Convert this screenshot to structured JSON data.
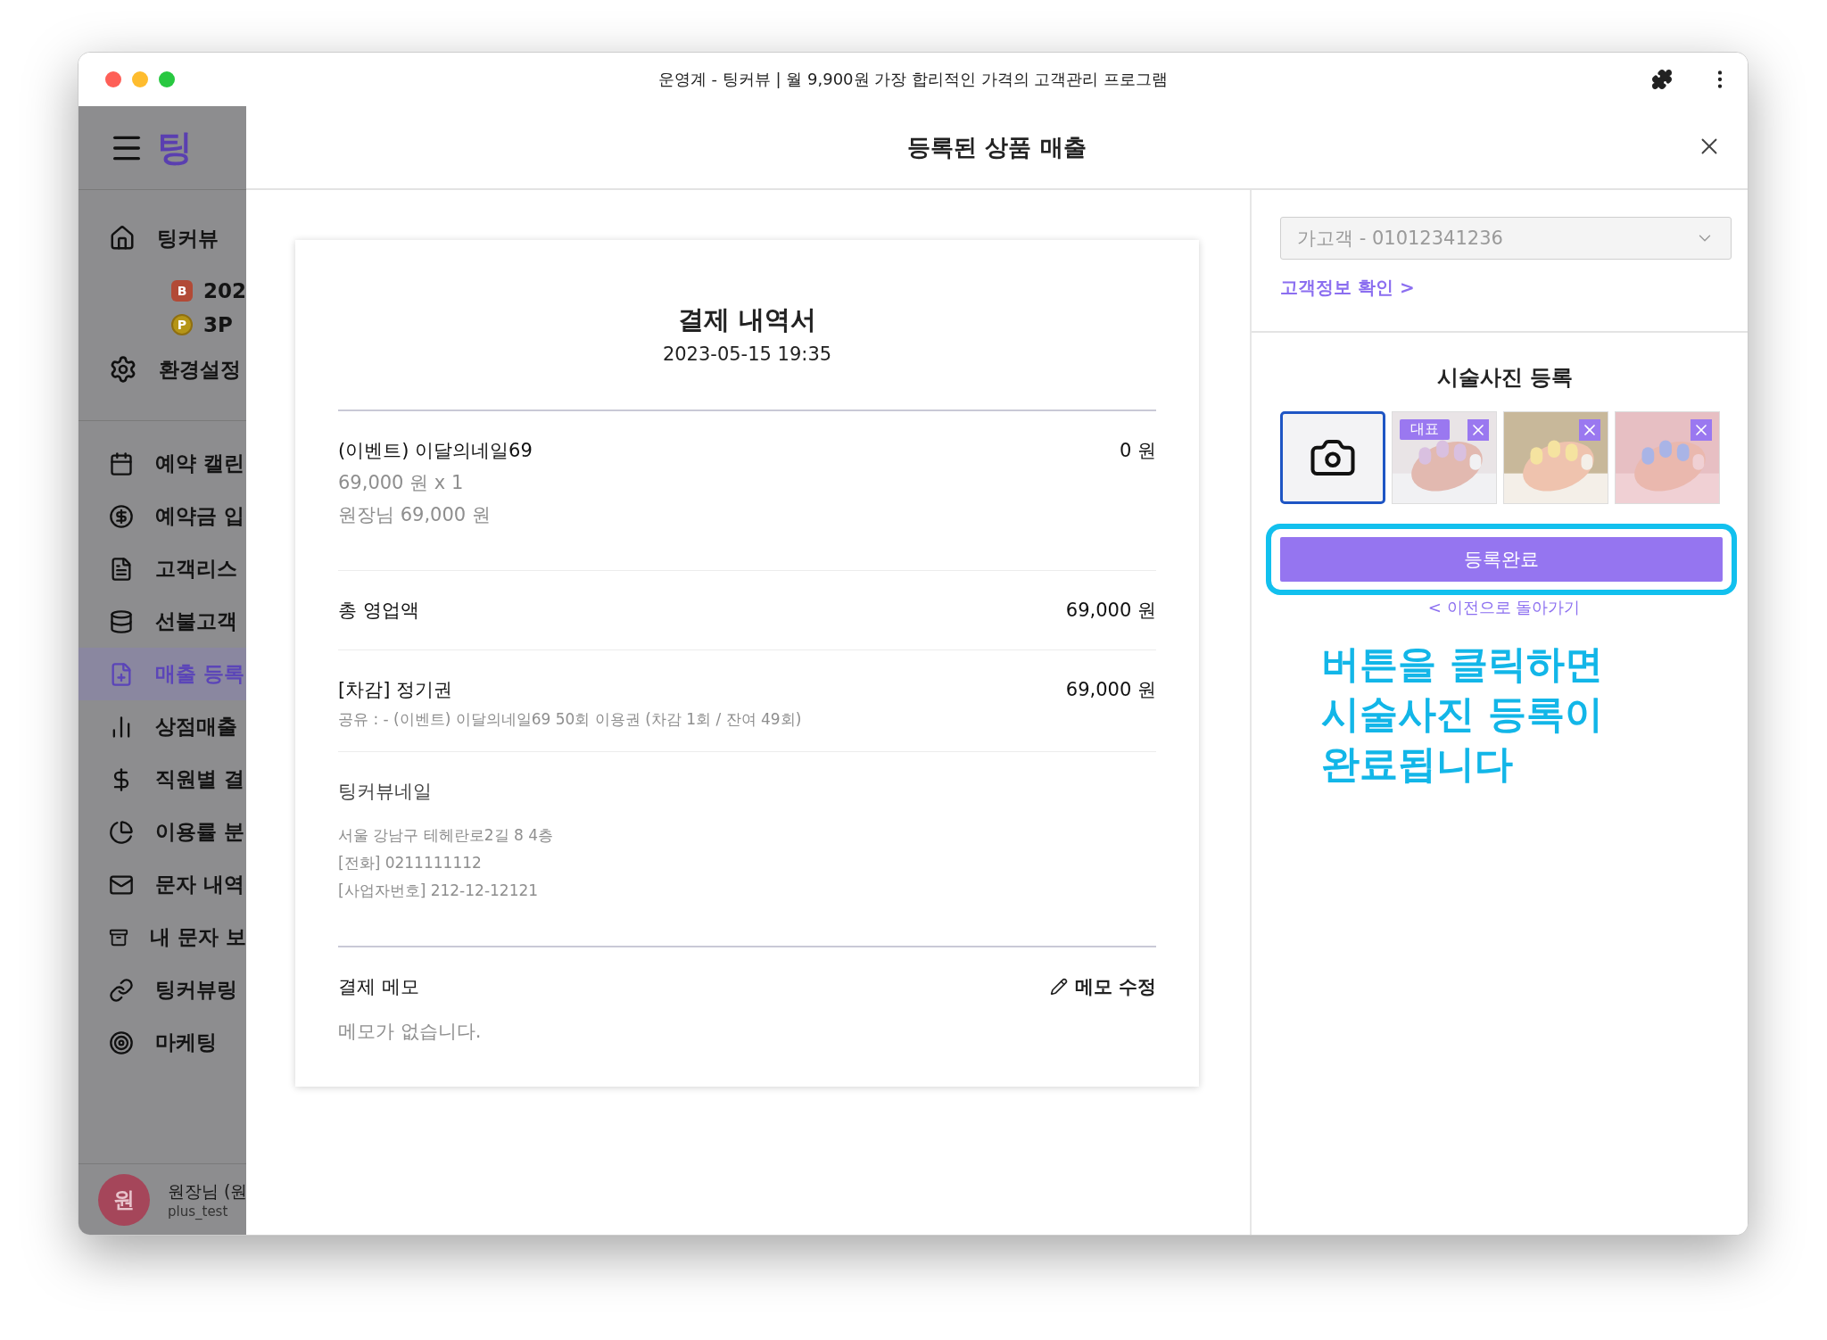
{
  "window": {
    "title": "운영계 - 팅커뷰 | 월 9,900원 가장 합리적인 가격의 고객관리 프로그램"
  },
  "sidebar": {
    "logo": "팅",
    "shop": "팅커뷰",
    "badges": [
      {
        "kind": "grade",
        "letter": "B",
        "text": "202"
      },
      {
        "kind": "point",
        "letter": "P",
        "text": "3P"
      }
    ],
    "settings": "환경설정",
    "items": [
      {
        "label": "예약 캘린",
        "selected": false
      },
      {
        "label": "예약금 입",
        "selected": false
      },
      {
        "label": "고객리스",
        "selected": false
      },
      {
        "label": "선불고객",
        "selected": false
      },
      {
        "label": "매출 등록",
        "selected": true
      },
      {
        "label": "상점매출",
        "selected": false
      },
      {
        "label": "직원별 결",
        "selected": false
      },
      {
        "label": "이용률 분",
        "selected": false
      },
      {
        "label": "문자 내역",
        "selected": false
      },
      {
        "label": "내 문자 보",
        "selected": false
      },
      {
        "label": "팅커뷰링",
        "selected": false
      },
      {
        "label": "마케팅",
        "selected": false
      }
    ],
    "user": {
      "avatar": "원",
      "name": "원장님 (원",
      "id": "plus_test"
    }
  },
  "modal": {
    "title": "등록된 상품 매출",
    "receipt": {
      "title": "결제 내역서",
      "date": "2023-05-15 19:35",
      "item": {
        "name": "(이벤트) 이달의네일69",
        "amount": "0 원",
        "lines": [
          "69,000 원 x 1",
          "원장님 69,000 원"
        ]
      },
      "total": {
        "label": "총 영업액",
        "amount": "69,000 원"
      },
      "deduction": {
        "label": "[차감] 정기권",
        "amount": "69,000 원",
        "note": "공유 : - (이벤트) 이달의네일69 50회 이용권 (차감 1회 / 잔여 49회)"
      },
      "shop": {
        "name": "팅커뷰네일",
        "lines": [
          "서울 강남구 테헤란로2길 8 4층",
          "[전화] 0211111112",
          "[사업자번호] 212-12-12121"
        ]
      },
      "memo": {
        "label": "결제 메모",
        "edit": "메모 수정",
        "empty": "메모가 없습니다."
      }
    },
    "panel": {
      "customer": "가고객 - 01012341236",
      "customer_link": "고객정보 확인 >",
      "photos_title": "시술사진 등록",
      "photos": [
        {
          "kind": "picture",
          "badge": "대표"
        },
        {
          "kind": "picture"
        },
        {
          "kind": "picture"
        }
      ],
      "submit": "등록완료",
      "back": "< 이전으로 돌아가기",
      "annotation": [
        "버튼을 클릭하면",
        "시술사진 등록이",
        "완료됩니다"
      ]
    }
  }
}
